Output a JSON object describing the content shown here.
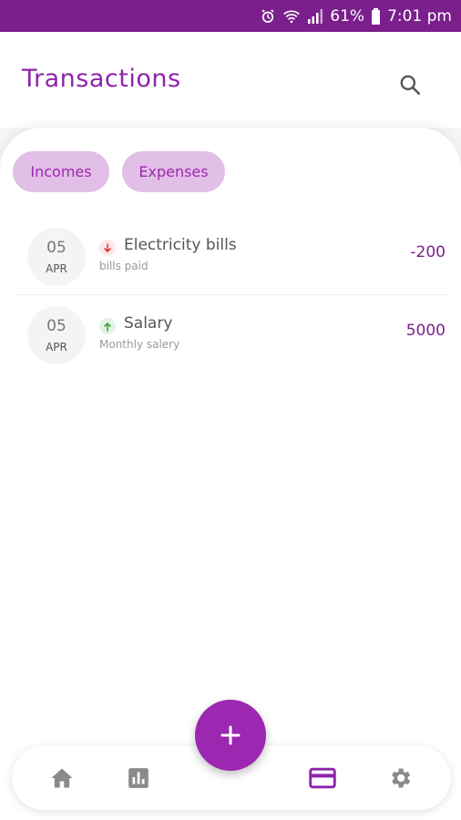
{
  "status_bar": {
    "battery": "61%",
    "time": "7:01 pm"
  },
  "app_bar": {
    "title": "Transactions"
  },
  "filters": [
    {
      "label": "Incomes"
    },
    {
      "label": "Expenses"
    }
  ],
  "transactions": [
    {
      "day": "05",
      "month": "APR",
      "title": "Electricity bills",
      "subtitle": "bills paid",
      "amount": "-200",
      "direction": "expense"
    },
    {
      "day": "05",
      "month": "APR",
      "title": "Salary",
      "subtitle": "Monthly salery",
      "amount": "5000",
      "direction": "income"
    }
  ],
  "bottom_nav": [
    {
      "icon": "home-icon"
    },
    {
      "icon": "bar-chart-icon"
    },
    {
      "icon": "credit-card-icon",
      "active": true
    },
    {
      "icon": "gear-icon"
    }
  ],
  "colors": {
    "primary": "#9c27b0",
    "primary_dark": "#7b1f8c",
    "chip_bg": "#e2bfe6",
    "expense": "#e53935",
    "income": "#43a047"
  }
}
